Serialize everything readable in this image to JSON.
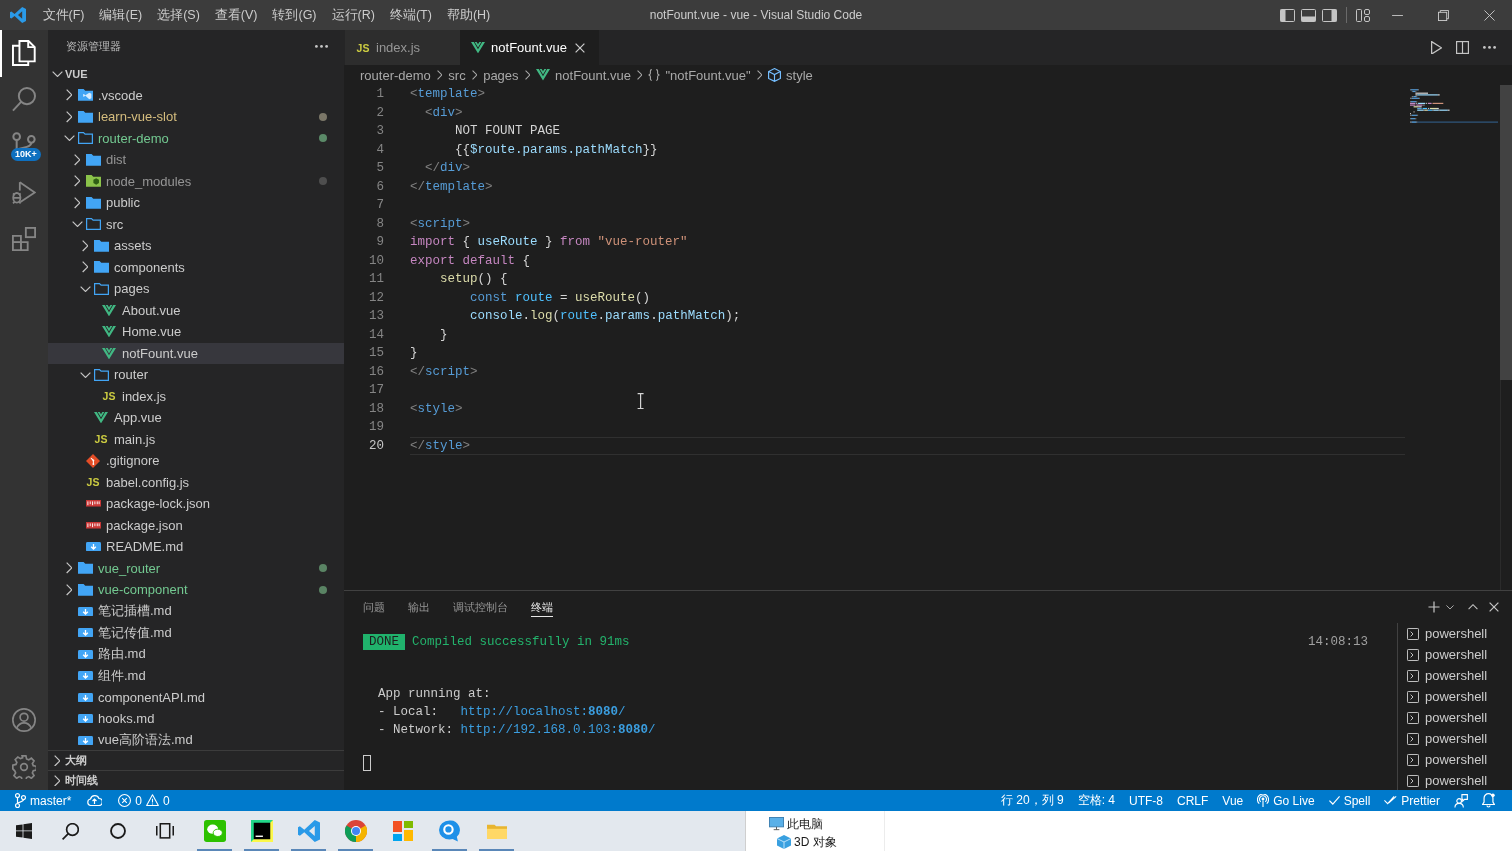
{
  "window": {
    "title": "notFount.vue - vue - Visual Studio Code"
  },
  "menu": [
    "文件(F)",
    "编辑(E)",
    "选择(S)",
    "查看(V)",
    "转到(G)",
    "运行(R)",
    "终端(T)",
    "帮助(H)"
  ],
  "activity_bar": {
    "items": [
      {
        "kind": "explorer",
        "selected": true
      },
      {
        "kind": "search",
        "selected": false
      },
      {
        "kind": "source_control",
        "selected": false,
        "badge": "10K+"
      },
      {
        "kind": "run_debug",
        "selected": false
      },
      {
        "kind": "extensions",
        "selected": false
      }
    ],
    "bottom": [
      {
        "kind": "account"
      },
      {
        "kind": "settings"
      }
    ]
  },
  "explorer": {
    "title": "资源管理器",
    "root": {
      "label": "VUE",
      "expanded": true,
      "children": [
        {
          "label": ".vscode",
          "kind": "vscode_folder",
          "expanded": false,
          "selected": false,
          "modified": false,
          "untracked": false,
          "ignored": false
        },
        {
          "label": "learn-vue-slot",
          "kind": "folder",
          "expanded": false,
          "selected": false,
          "modified": true,
          "untracked": false,
          "ignored": false,
          "color": "#7b7768"
        },
        {
          "label": "router-demo",
          "kind": "folder",
          "expanded": true,
          "selected": false,
          "modified": false,
          "untracked": true,
          "ignored": false,
          "color": "#5b8a68",
          "children": [
            {
              "label": "dist",
              "kind": "folder",
              "expanded": false,
              "selected": false,
              "modified": false,
              "untracked": false,
              "ignored": true
            },
            {
              "label": "node_modules",
              "kind": "node_folder",
              "expanded": false,
              "selected": false,
              "modified": false,
              "untracked": false,
              "ignored": true,
              "color": "#4e4e4e"
            },
            {
              "label": "public",
              "kind": "folder",
              "expanded": false,
              "selected": false,
              "modified": false,
              "untracked": false,
              "ignored": false
            },
            {
              "label": "src",
              "kind": "folder",
              "expanded": true,
              "selected": false,
              "modified": false,
              "untracked": false,
              "ignored": false,
              "children": [
                {
                  "label": "assets",
                  "kind": "folder",
                  "expanded": false,
                  "selected": false,
                  "modified": false,
                  "untracked": false,
                  "ignored": false
                },
                {
                  "label": "components",
                  "kind": "folder",
                  "expanded": false,
                  "selected": false,
                  "modified": false,
                  "untracked": false,
                  "ignored": false
                },
                {
                  "label": "pages",
                  "kind": "folder",
                  "expanded": true,
                  "selected": false,
                  "modified": false,
                  "untracked": false,
                  "ignored": false,
                  "children": [
                    {
                      "label": "About.vue",
                      "kind": "vue",
                      "selected": false,
                      "modified": false,
                      "untracked": false,
                      "ignored": false
                    },
                    {
                      "label": "Home.vue",
                      "kind": "vue",
                      "selected": false,
                      "modified": false,
                      "untracked": false,
                      "ignored": false
                    },
                    {
                      "label": "notFount.vue",
                      "kind": "vue",
                      "selected": true,
                      "modified": false,
                      "untracked": false,
                      "ignored": false
                    }
                  ]
                },
                {
                  "label": "router",
                  "kind": "folder",
                  "expanded": true,
                  "selected": false,
                  "modified": false,
                  "untracked": false,
                  "ignored": false,
                  "children": [
                    {
                      "label": "index.js",
                      "kind": "js",
                      "icon_text": "JS",
                      "selected": false,
                      "modified": false,
                      "untracked": false,
                      "ignored": false
                    }
                  ]
                },
                {
                  "label": "App.vue",
                  "kind": "vue",
                  "selected": false,
                  "modified": false,
                  "untracked": false,
                  "ignored": false
                },
                {
                  "label": "main.js",
                  "kind": "js",
                  "icon_text": "JS",
                  "selected": false,
                  "modified": false,
                  "untracked": false,
                  "ignored": false
                }
              ]
            },
            {
              "label": ".gitignore",
              "kind": "git",
              "selected": false,
              "modified": false,
              "untracked": false,
              "ignored": false
            },
            {
              "label": "babel.config.js",
              "kind": "js",
              "icon_text": "JS",
              "selected": false,
              "modified": false,
              "untracked": false,
              "ignored": false
            },
            {
              "label": "package-lock.json",
              "kind": "npm",
              "selected": false,
              "modified": false,
              "untracked": false,
              "ignored": false
            },
            {
              "label": "package.json",
              "kind": "npm",
              "selected": false,
              "modified": false,
              "untracked": false,
              "ignored": false
            },
            {
              "label": "README.md",
              "kind": "md",
              "selected": false,
              "modified": false,
              "untracked": false,
              "ignored": false
            }
          ]
        },
        {
          "label": "vue_router",
          "kind": "folder",
          "expanded": false,
          "selected": false,
          "modified": false,
          "untracked": true,
          "ignored": false,
          "color": "#5a8464"
        },
        {
          "label": "vue-component",
          "kind": "folder",
          "expanded": false,
          "selected": false,
          "modified": false,
          "untracked": true,
          "ignored": false,
          "color": "#5a8464"
        },
        {
          "label": "笔记插槽.md",
          "kind": "md",
          "selected": false,
          "modified": false,
          "untracked": false,
          "ignored": false
        },
        {
          "label": "笔记传值.md",
          "kind": "md",
          "selected": false,
          "modified": false,
          "untracked": false,
          "ignored": false
        },
        {
          "label": "路由.md",
          "kind": "md",
          "selected": false,
          "modified": false,
          "untracked": false,
          "ignored": false
        },
        {
          "label": "组件.md",
          "kind": "md",
          "selected": false,
          "modified": false,
          "untracked": false,
          "ignored": false
        },
        {
          "label": "componentAPI.md",
          "kind": "md",
          "selected": false,
          "modified": false,
          "untracked": false,
          "ignored": false
        },
        {
          "label": "hooks.md",
          "kind": "md",
          "selected": false,
          "modified": false,
          "untracked": false,
          "ignored": false
        },
        {
          "label": "vue高阶语法.md",
          "kind": "md",
          "selected": false,
          "modified": false,
          "untracked": false,
          "ignored": false
        }
      ]
    },
    "sections": [
      {
        "label": "大纲",
        "expanded": false
      },
      {
        "label": "时间线",
        "expanded": false
      }
    ]
  },
  "editor": {
    "tabs": [
      {
        "label": "index.js",
        "kind": "js",
        "icon_text": "JS",
        "selected": false
      },
      {
        "label": "notFount.vue",
        "kind": "vue",
        "selected": true
      }
    ],
    "breadcrumb": [
      {
        "label": "router-demo",
        "kind": "folder"
      },
      {
        "label": "src",
        "kind": "folder"
      },
      {
        "label": "pages",
        "kind": "folder"
      },
      {
        "label": "notFount.vue",
        "kind": "vue"
      },
      {
        "label": "\"notFount.vue\"",
        "kind": "object"
      },
      {
        "label": "style",
        "kind": "element"
      }
    ],
    "lines": [
      {
        "number": "1",
        "current": false,
        "tokens": [
          {
            "text": "<",
            "kind": "punct"
          },
          {
            "text": "template",
            "kind": "tag"
          },
          {
            "text": ">",
            "kind": "punct"
          }
        ]
      },
      {
        "number": "2",
        "current": false,
        "tokens": [
          {
            "text": "  <",
            "kind": "punct"
          },
          {
            "text": "div",
            "kind": "tag"
          },
          {
            "text": ">",
            "kind": "punct"
          }
        ]
      },
      {
        "number": "3",
        "current": false,
        "tokens": [
          {
            "text": "      NOT FOUNT PAGE",
            "kind": "plain"
          }
        ]
      },
      {
        "number": "4",
        "current": false,
        "tokens": [
          {
            "text": "      {{",
            "kind": "plain"
          },
          {
            "text": "$route.params.pathMatch",
            "kind": "var"
          },
          {
            "text": "}}",
            "kind": "plain"
          }
        ]
      },
      {
        "number": "5",
        "current": false,
        "tokens": [
          {
            "text": "  </",
            "kind": "punct"
          },
          {
            "text": "div",
            "kind": "tag"
          },
          {
            "text": ">",
            "kind": "punct"
          }
        ]
      },
      {
        "number": "6",
        "current": false,
        "tokens": [
          {
            "text": "</",
            "kind": "punct"
          },
          {
            "text": "template",
            "kind": "tag"
          },
          {
            "text": ">",
            "kind": "punct"
          }
        ]
      },
      {
        "number": "7",
        "current": false
      },
      {
        "number": "8",
        "current": false,
        "tokens": [
          {
            "text": "<",
            "kind": "punct"
          },
          {
            "text": "script",
            "kind": "tag"
          },
          {
            "text": ">",
            "kind": "punct"
          }
        ]
      },
      {
        "number": "9",
        "current": false,
        "tokens": [
          {
            "text": "import",
            "kind": "keyword"
          },
          {
            "text": " { ",
            "kind": "plain"
          },
          {
            "text": "useRoute",
            "kind": "var"
          },
          {
            "text": " } ",
            "kind": "plain"
          },
          {
            "text": "from ",
            "kind": "keyword"
          },
          {
            "text": "\"vue-router\"",
            "kind": "string"
          }
        ]
      },
      {
        "number": "10",
        "current": false,
        "tokens": [
          {
            "text": "export ",
            "kind": "keyword"
          },
          {
            "text": "default",
            "kind": "keyword"
          },
          {
            "text": " {",
            "kind": "plain"
          }
        ]
      },
      {
        "number": "11",
        "current": false,
        "tokens": [
          {
            "text": "    setup",
            "kind": "func"
          },
          {
            "text": "() {",
            "kind": "plain"
          }
        ]
      },
      {
        "number": "12",
        "current": false,
        "tokens": [
          {
            "text": "        const ",
            "kind": "storage"
          },
          {
            "text": "route",
            "kind": "const"
          },
          {
            "text": " = ",
            "kind": "plain"
          },
          {
            "text": "useRoute",
            "kind": "func"
          },
          {
            "text": "()",
            "kind": "plain"
          }
        ]
      },
      {
        "number": "13",
        "current": false,
        "tokens": [
          {
            "text": "        console",
            "kind": "var"
          },
          {
            "text": ".",
            "kind": "plain"
          },
          {
            "text": "log",
            "kind": "func"
          },
          {
            "text": "(",
            "kind": "plain"
          },
          {
            "text": "route",
            "kind": "const"
          },
          {
            "text": ".",
            "kind": "plain"
          },
          {
            "text": "params",
            "kind": "var"
          },
          {
            "text": ".",
            "kind": "plain"
          },
          {
            "text": "pathMatch",
            "kind": "var"
          },
          {
            "text": ");",
            "kind": "plain"
          }
        ]
      },
      {
        "number": "14",
        "current": false,
        "tokens": [
          {
            "text": "    }",
            "kind": "plain"
          }
        ]
      },
      {
        "number": "15",
        "current": false,
        "tokens": [
          {
            "text": "}",
            "kind": "plain"
          }
        ]
      },
      {
        "number": "16",
        "current": false,
        "tokens": [
          {
            "text": "</",
            "kind": "punct"
          },
          {
            "text": "script",
            "kind": "tag"
          },
          {
            "text": ">",
            "kind": "punct"
          }
        ]
      },
      {
        "number": "17",
        "current": false
      },
      {
        "number": "18",
        "current": false,
        "tokens": [
          {
            "text": "<",
            "kind": "punct"
          },
          {
            "text": "style",
            "kind": "tag"
          },
          {
            "text": ">",
            "kind": "punct"
          }
        ]
      },
      {
        "number": "19",
        "current": false
      },
      {
        "number": "20",
        "current": true,
        "tokens": [
          {
            "text": "</",
            "kind": "punct"
          },
          {
            "text": "style",
            "kind": "tag"
          },
          {
            "text": ">",
            "kind": "punct"
          }
        ]
      }
    ]
  },
  "panel": {
    "tabs": [
      {
        "label": "问题",
        "selected": false
      },
      {
        "label": "输出",
        "selected": false
      },
      {
        "label": "调试控制台",
        "selected": false
      },
      {
        "label": "终端",
        "selected": true
      }
    ],
    "terminal": {
      "lines": [
        {
          "kind": "status",
          "badge": "DONE",
          "text": "Compiled successfully in 91ms",
          "time": "14:08:13"
        },
        {
          "kind": "text",
          "text": "  App running at:"
        },
        {
          "kind": "link",
          "label": "  - Local:   ",
          "url": "http://localhost:**8080**/"
        },
        {
          "kind": "link",
          "label": "  - Network: ",
          "url": "http://192.168.0.103:**8080**/"
        },
        {
          "kind": "prompt"
        }
      ]
    },
    "sessions": [
      {
        "label": "powershell"
      },
      {
        "label": "powershell"
      },
      {
        "label": "powershell"
      },
      {
        "label": "powershell"
      },
      {
        "label": "powershell"
      },
      {
        "label": "powershell"
      },
      {
        "label": "powershell"
      },
      {
        "label": "powershell"
      }
    ]
  },
  "status_bar": {
    "left": [
      {
        "kind": "branch",
        "label": "master*"
      },
      {
        "kind": "sync"
      },
      {
        "kind": "problems",
        "errors": "0",
        "warnings": "0"
      }
    ],
    "right": [
      {
        "kind": "text",
        "label": "行 20，列 9"
      },
      {
        "kind": "text",
        "label": "空格: 4"
      },
      {
        "kind": "text",
        "label": "UTF-8"
      },
      {
        "kind": "text",
        "label": "CRLF"
      },
      {
        "kind": "text",
        "label": "Vue"
      },
      {
        "kind": "golive",
        "label": "Go Live"
      },
      {
        "kind": "check",
        "label": "Spell"
      },
      {
        "kind": "double_check",
        "label": "Prettier"
      },
      {
        "kind": "feedback"
      },
      {
        "kind": "bell"
      }
    ]
  },
  "taskbar": {
    "items": [
      {
        "kind": "start",
        "running": false
      },
      {
        "kind": "search",
        "running": false
      },
      {
        "kind": "cortana",
        "running": false
      },
      {
        "kind": "task_view",
        "running": false
      },
      {
        "kind": "chat",
        "running": true
      },
      {
        "kind": "ide",
        "running": true
      },
      {
        "kind": "editor",
        "running": true
      },
      {
        "kind": "browser",
        "running": true
      },
      {
        "kind": "blocks",
        "running": false
      },
      {
        "kind": "messenger",
        "running": true
      },
      {
        "kind": "files",
        "running": true
      }
    ]
  },
  "explorer_window": {
    "nav": [
      {
        "label": "此电脑",
        "kind": "pc",
        "children": [
          {
            "label": "3D 对象",
            "kind": "objects3d"
          }
        ]
      }
    ]
  }
}
